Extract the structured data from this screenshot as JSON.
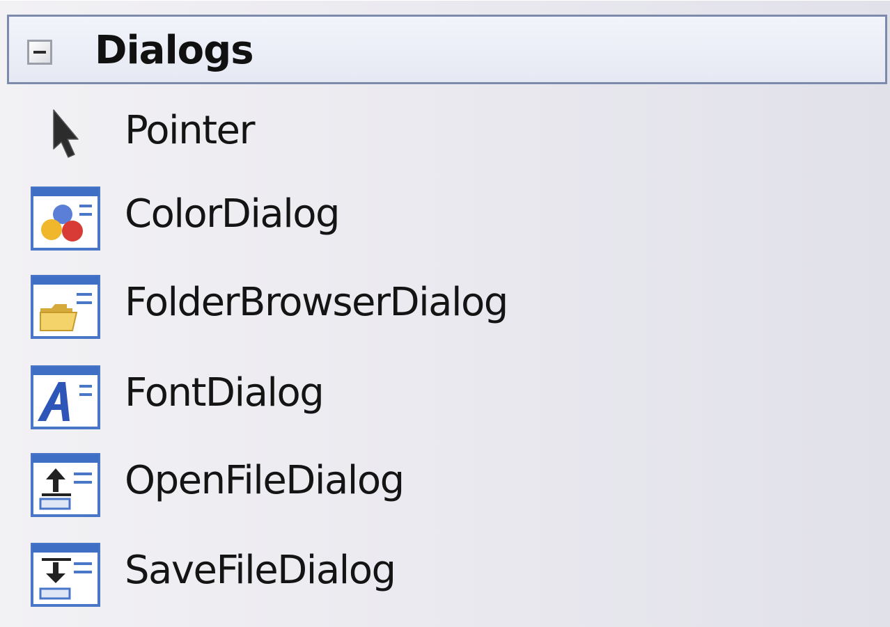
{
  "toolbox": {
    "group": {
      "title": "Dialogs",
      "expand_state_icon": "collapse-minus-icon",
      "items": [
        {
          "label": "Pointer",
          "icon": "pointer-arrow-icon"
        },
        {
          "label": "ColorDialog",
          "icon": "color-dialog-icon"
        },
        {
          "label": "FolderBrowserDialog",
          "icon": "folder-browser-dialog-icon"
        },
        {
          "label": "FontDialog",
          "icon": "font-dialog-icon"
        },
        {
          "label": "OpenFileDialog",
          "icon": "open-file-dialog-icon"
        },
        {
          "label": "SaveFileDialog",
          "icon": "save-file-dialog-icon"
        }
      ]
    },
    "colors": {
      "header_border": "#7c8aac",
      "dialog_titlebar": "#3f6fc4",
      "panel_background": "#ebeaf0"
    }
  }
}
